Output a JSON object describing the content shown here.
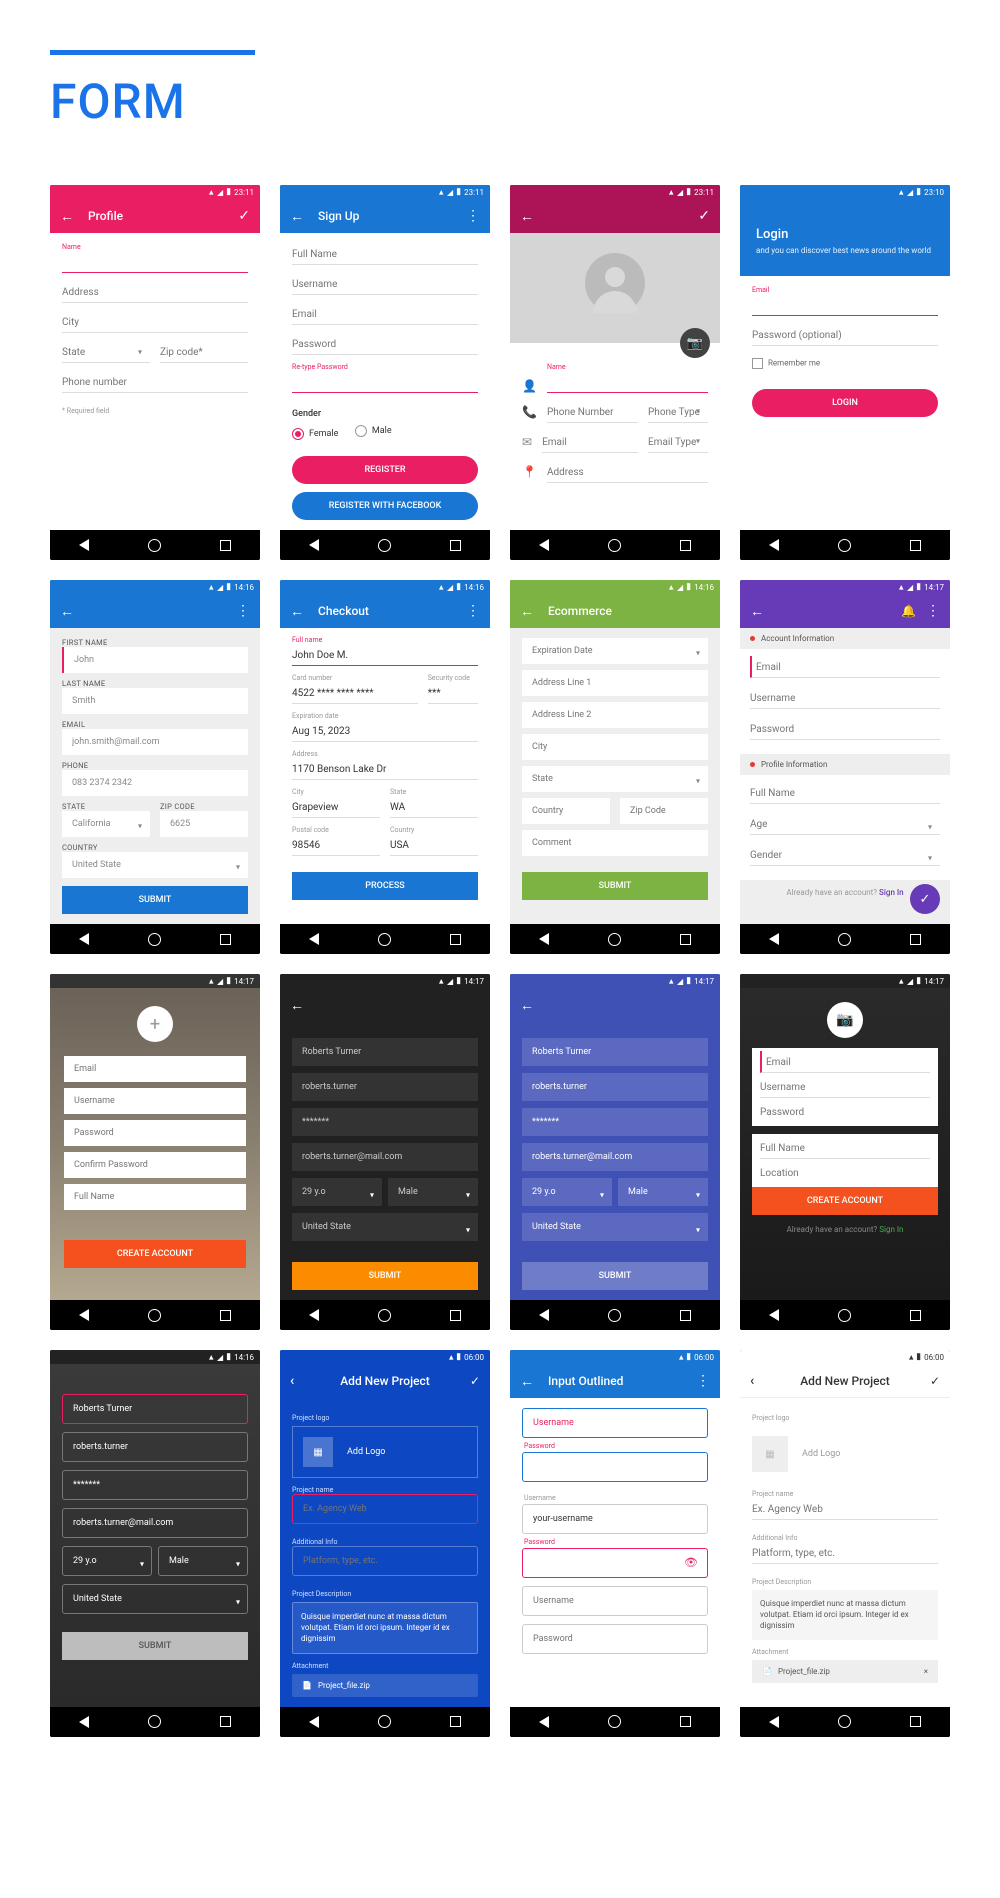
{
  "page": {
    "title": "FORM"
  },
  "status": {
    "time1": "23:11",
    "time2": "23:10",
    "time3": "14:16",
    "time4": "14:17",
    "time5": "06:00"
  },
  "s1": {
    "title": "Profile",
    "name_label": "Name",
    "address": "Address",
    "city": "City",
    "state": "State",
    "zip": "Zip code*",
    "phone": "Phone number",
    "req": "* Required field"
  },
  "s2": {
    "title": "Sign Up",
    "fn": "Full Name",
    "un": "Username",
    "em": "Email",
    "pw": "Password",
    "rpw": "Re-type Password",
    "gender": "Gender",
    "female": "Female",
    "male": "Male",
    "register": "REGISTER",
    "fb": "REGISTER WITH FACEBOOK"
  },
  "s3": {
    "name": "Name",
    "phone": "Phone Number",
    "ptype": "Phone Type",
    "email": "Email",
    "etype": "Email Type",
    "address": "Address"
  },
  "s4": {
    "title": "Login",
    "sub": "and you can discover best news around the world",
    "email": "Email",
    "pw": "Password (optional)",
    "remember": "Remember me",
    "login": "LOGIN"
  },
  "s5": {
    "fn_l": "FIRST NAME",
    "fn": "John",
    "ln_l": "LAST NAME",
    "ln": "Smith",
    "em_l": "EMAIL",
    "em": "john.smith@mail.com",
    "ph_l": "PHONE",
    "ph": "083 2374 2342",
    "st_l": "STATE",
    "st": "California",
    "zp_l": "ZIP CODE",
    "zp": "6625",
    "co_l": "COUNTRY",
    "co": "United State",
    "submit": "SUBMIT"
  },
  "s6": {
    "title": "Checkout",
    "fn_l": "Full name",
    "fn": "John Doe M.",
    "cn_l": "Card number",
    "cn": "4522 **** **** ****",
    "sc_l": "Security code",
    "sc": "***",
    "ex_l": "Expiration date",
    "ex": "Aug 15, 2023",
    "ad_l": "Address",
    "ad": "1170 Benson Lake Dr",
    "ci_l": "City",
    "ci": "Grapeview",
    "st_l": "State",
    "st": "WA",
    "pc_l": "Postal code",
    "pc": "98546",
    "co_l": "Country",
    "co": "USA",
    "process": "PROCESS"
  },
  "s7": {
    "title": "Ecommerce",
    "exp": "Expiration Date",
    "a1": "Address Line 1",
    "a2": "Address Line 2",
    "city": "City",
    "state": "State",
    "country": "Country",
    "zip": "Zip Code",
    "comment": "Comment",
    "submit": "SUBMIT"
  },
  "s8": {
    "sec1": "Account Information",
    "email": "Email",
    "un": "Username",
    "pw": "Password",
    "sec2": "Profile Information",
    "fn": "Full Name",
    "age": "Age",
    "gender": "Gender",
    "already": "Already have an account? ",
    "signin": "Sign In"
  },
  "s9": {
    "email": "Email",
    "un": "Username",
    "pw": "Password",
    "cpw": "Confirm Password",
    "fn": "Full Name",
    "create": "CREATE ACCOUNT"
  },
  "s10": {
    "name": "Roberts Turner",
    "un": "roberts.turner",
    "pw": "*******",
    "em": "roberts.turner@mail.com",
    "age": "29 y.o",
    "gender": "Male",
    "country": "United State",
    "submit": "SUBMIT"
  },
  "s11": {
    "name": "Roberts Turner",
    "un": "roberts.turner",
    "pw": "*******",
    "em": "roberts.turner@mail.com",
    "age": "29 y.o",
    "gender": "Male",
    "country": "United State",
    "submit": "SUBMIT"
  },
  "s12": {
    "email": "Email",
    "un": "Username",
    "pw": "Password",
    "fn": "Full Name",
    "loc": "Location",
    "create": "CREATE ACCOUNT",
    "already": "Already have an account? ",
    "signin": "Sign In"
  },
  "s13": {
    "name": "Roberts Turner",
    "un": "roberts.turner",
    "pw": "*******",
    "em": "roberts.turner@mail.com",
    "age": "29 y.o",
    "gender": "Male",
    "country": "United State",
    "submit": "SUBMIT"
  },
  "s14": {
    "title": "Add New Project",
    "logo_l": "Project logo",
    "add_logo": "Add Logo",
    "pn_l": "Project name",
    "pn": "Ex. Agency Web",
    "ai_l": "Additional Info",
    "ai": "Platform, type, etc.",
    "pd_l": "Project Description",
    "desc": "Quisque imperdiet nunc at massa dictum volutpat. Etiam id orci ipsum. Integer id ex dignissim",
    "at_l": "Attachment",
    "file": "Project_file.zip"
  },
  "s15": {
    "title": "Input Outlined",
    "un": "Username",
    "pw_l": "Password",
    "un2_l": "Username",
    "un2": "your-username",
    "pw2_l": "Password",
    "un3": "Username",
    "pw3": "Password"
  },
  "s16": {
    "title": "Add New Project",
    "logo_l": "Project logo",
    "add_logo": "Add Logo",
    "pn_l": "Project name",
    "pn": "Ex. Agency Web",
    "ai_l": "Additional Info",
    "ai": "Platform, type, etc.",
    "pd_l": "Project Description",
    "desc": "Quisque imperdiet nunc at massa dictum volutpat. Etiam id orci ipsum. Integer id ex dignissim",
    "at_l": "Attachment",
    "file": "Project_file.zip"
  }
}
